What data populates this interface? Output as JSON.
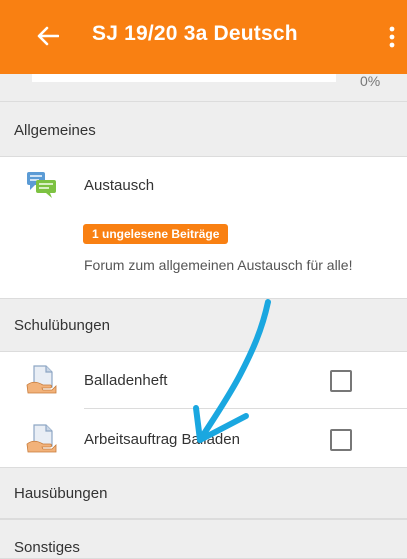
{
  "appbar": {
    "title": "SJ 19/20 3a Deutsch",
    "back_icon": "arrow-left-icon",
    "menu_icon": "more-vert-icon",
    "color": "#f98012"
  },
  "progress": {
    "label": "0%",
    "value": 0
  },
  "sections": {
    "allgemeines": {
      "title": "Allgemeines",
      "activity": {
        "name": "Austausch",
        "icon": "forum-icon",
        "badge": "1 ungelesene Beiträge",
        "description": "Forum zum allgemeinen Austausch für alle!"
      }
    },
    "schuluebungen": {
      "title": "Schulübungen",
      "activities": [
        {
          "name": "Balladenheft",
          "icon": "assignment-icon",
          "completed": false
        },
        {
          "name": "Arbeitsauftrag Balladen",
          "icon": "assignment-icon",
          "completed": false
        }
      ]
    },
    "hausuebungen": {
      "title": "Hausübungen"
    },
    "sonstiges": {
      "title": "Sonstiges"
    }
  },
  "colors": {
    "accent": "#f98012",
    "section_background": "#eeeeee",
    "annotation_arrow": "#1aa7e0"
  }
}
